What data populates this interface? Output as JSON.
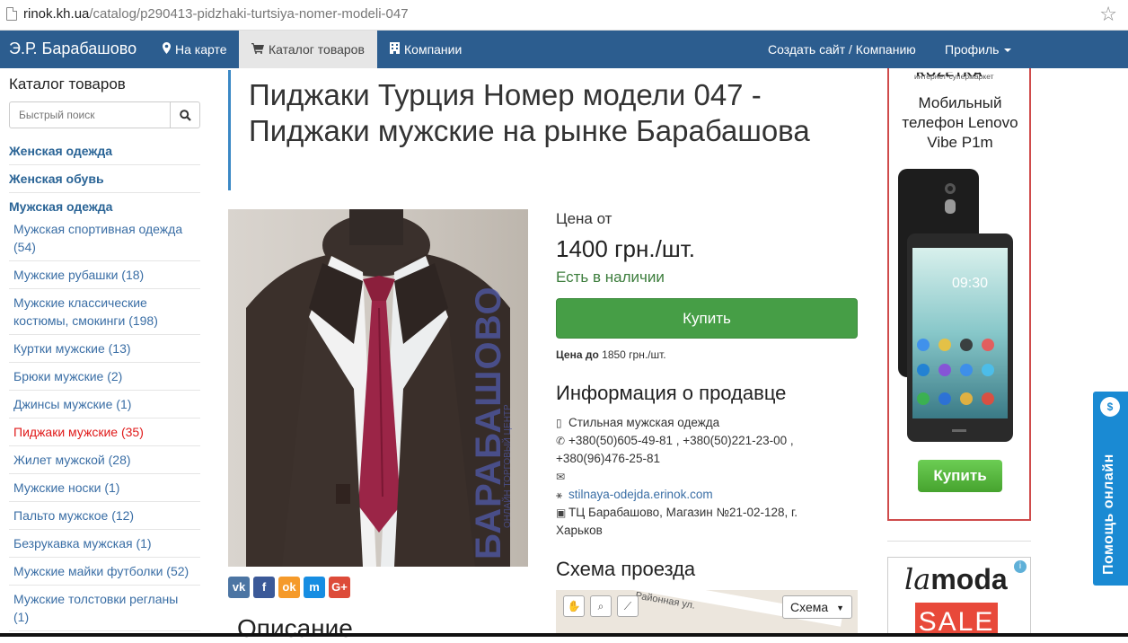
{
  "browser": {
    "url_host": "rinok.kh.ua",
    "url_path": "/catalog/p290413-pidzhaki-turtsiya-nomer-modeli-047"
  },
  "navbar": {
    "brand": "Э.Р. Барабашово",
    "map_label": "На карте",
    "catalog_label": "Каталог товаров",
    "companies_label": "Компании",
    "create_label": "Создать сайт / Компанию",
    "profile_label": "Профиль"
  },
  "sidebar": {
    "heading": "Каталог товаров",
    "search_placeholder": "Быстрый поиск",
    "top_categories": [
      "Женская одежда",
      "Женская обувь",
      "Мужская одежда"
    ],
    "subcategories": [
      {
        "label": "Мужская спортивная одежда (54)",
        "active": false
      },
      {
        "label": "Мужские рубашки (18)",
        "active": false
      },
      {
        "label": "Мужские классические костюмы, смокинги (198)",
        "active": false
      },
      {
        "label": "Куртки мужские (13)",
        "active": false
      },
      {
        "label": "Брюки мужские (2)",
        "active": false
      },
      {
        "label": "Джинсы мужские (1)",
        "active": false
      },
      {
        "label": "Пиджаки мужские (35)",
        "active": true
      },
      {
        "label": "Жилет мужской (28)",
        "active": false
      },
      {
        "label": "Мужские носки (1)",
        "active": false
      },
      {
        "label": "Пальто мужское (12)",
        "active": false
      },
      {
        "label": "Безрукавка мужская (1)",
        "active": false
      },
      {
        "label": "Мужские майки футболки (52)",
        "active": false
      },
      {
        "label": "Мужские толстовки регланы (1)",
        "active": false
      }
    ]
  },
  "product": {
    "title": "Пиджаки Турция Номер модели 047 - Пиджаки мужские на рынке Барабашова",
    "price_from_label": "Цена от",
    "price": "1400 грн./шт.",
    "stock": "Есть в наличии",
    "buy_label": "Купить",
    "price_to_label": "Цена до",
    "price_to_value": "1850 грн./шт.",
    "description_heading": "Описание",
    "watermark": "БАРАБАШОВО",
    "watermark_sub": "ОНЛАЙН ТОРГОВЫЙ ЦЕНТР"
  },
  "seller": {
    "heading": "Информация о продавце",
    "name": "Стильная мужская одежда",
    "phones": "+380(50)605-49-81 , +380(50)221-23-00 , +380(96)476-25-81",
    "site": "stilnaya-odejda.erinok.com",
    "address": "ТЦ Барабашово, Магазин №21-02-128, г. Харьков"
  },
  "route": {
    "heading": "Схема проезда",
    "road_label": "Районная ул.",
    "map_type": "Схема"
  },
  "share": {
    "buttons": [
      "vk",
      "f",
      "ok",
      "m",
      "G+"
    ],
    "colors": [
      "#4c75a3",
      "#3b5998",
      "#f59a2a",
      "#168de2",
      "#dd4b39"
    ]
  },
  "ads": {
    "ad1_brand": "ROZETKA",
    "ad1_tagline": "интернет-супермаркет",
    "ad1_product": "Мобильный телефон Lenovo Vibe P1m",
    "ad1_phone_time": "09:30",
    "ad1_buy": "Купить",
    "ad2_brand_1": "la",
    "ad2_brand_2": "moda",
    "ad2_sale": "SALE"
  },
  "help": {
    "label": "Помощь онлайн"
  },
  "colors": {
    "navbar": "#2c5d8f",
    "link": "#3a6ea5",
    "active_category": "#e01a1a",
    "buy_button": "#469e46",
    "help_tab": "#1a8ad3"
  }
}
